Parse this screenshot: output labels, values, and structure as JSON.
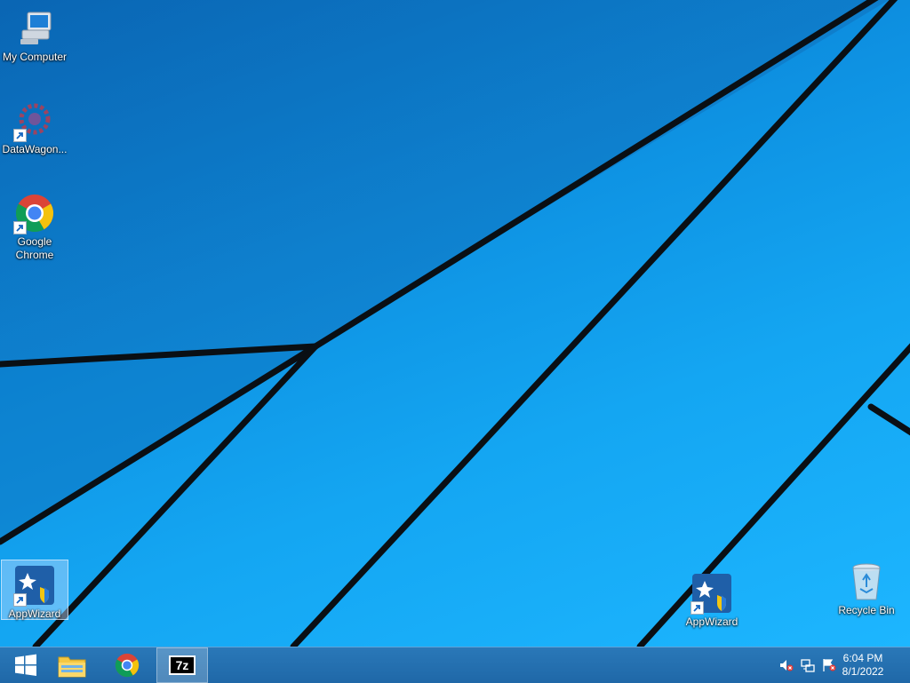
{
  "desktop": {
    "icons": [
      {
        "label": "My Computer",
        "icon": "computer-icon",
        "shortcut": false
      },
      {
        "label": "DataWagon...",
        "icon": "datawagon-icon",
        "shortcut": true
      },
      {
        "label": "Google Chrome",
        "icon": "chrome-icon",
        "shortcut": true
      },
      {
        "label": "AppWizard",
        "icon": "appwizard-icon",
        "shortcut": true,
        "selected": true
      },
      {
        "label": "AppWizard",
        "icon": "appwizard-icon",
        "shortcut": true
      },
      {
        "label": "Recycle Bin",
        "icon": "recycle-bin-icon",
        "shortcut": false
      }
    ]
  },
  "taskbar": {
    "buttons": [
      {
        "name": "start",
        "icon": "windows-logo-icon"
      },
      {
        "name": "file-explorer",
        "icon": "file-explorer-icon"
      },
      {
        "name": "chrome",
        "icon": "chrome-icon"
      },
      {
        "name": "7zip",
        "icon": "7zip-icon",
        "text": "7z",
        "active": true
      }
    ],
    "tray": {
      "icons": [
        "volume-muted-icon",
        "network-icon",
        "action-center-flag-icon"
      ],
      "time": "6:04 PM",
      "date": "8/1/2022"
    }
  },
  "colors": {
    "desktop_blue": "#14a6f2",
    "taskbar_blue": "#2170ae"
  }
}
